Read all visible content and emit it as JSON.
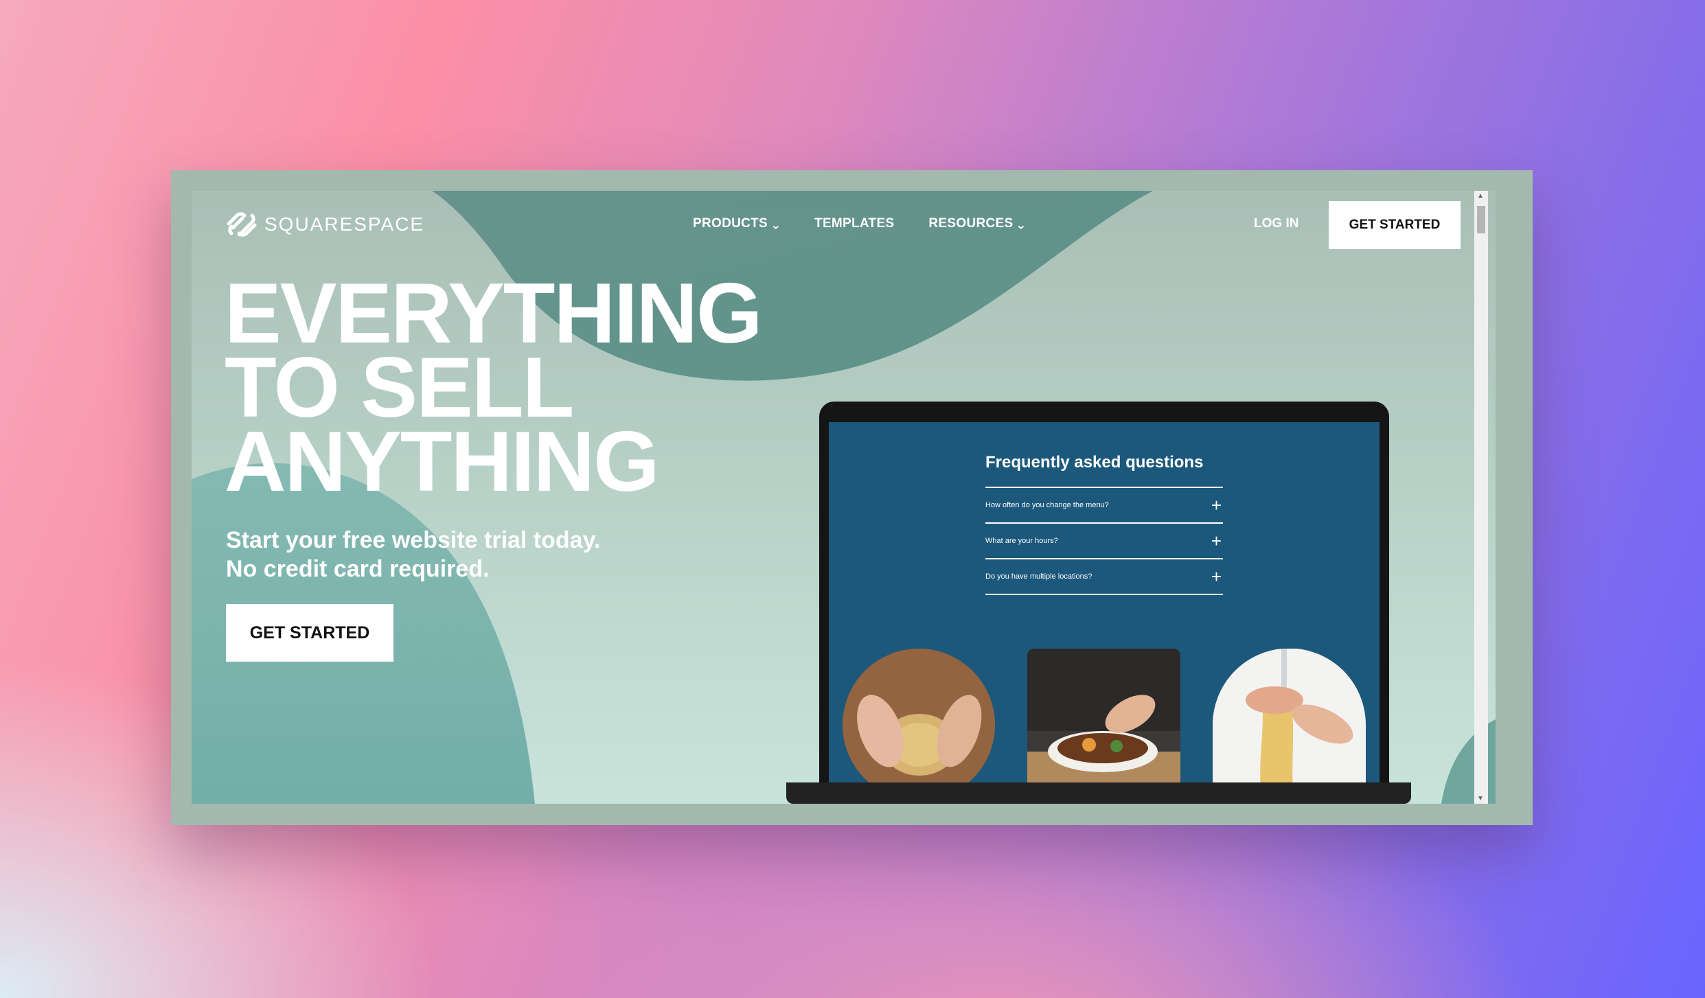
{
  "brand": {
    "name": "SQUARESPACE",
    "icon": "squarespace-logo-icon"
  },
  "nav": {
    "items": [
      {
        "label": "PRODUCTS",
        "has_dropdown": true
      },
      {
        "label": "TEMPLATES",
        "has_dropdown": false
      },
      {
        "label": "RESOURCES",
        "has_dropdown": true
      }
    ],
    "login": "LOG IN",
    "cta": "GET STARTED"
  },
  "hero": {
    "headline": [
      "EVERYTHING",
      "TO SELL",
      "ANYTHING"
    ],
    "subline_1": "Start your free website trial today.",
    "subline_2": "No credit card required.",
    "cta": "GET STARTED"
  },
  "laptop_screen": {
    "faq_title": "Frequently asked questions",
    "faq_items": [
      "How often do you change the menu?",
      "What are your hours?",
      "Do you have multiple locations?"
    ]
  },
  "colors": {
    "screen_bg": "#1c587b",
    "hero_green": "#5e978e",
    "frame": "#a3b9ae"
  }
}
